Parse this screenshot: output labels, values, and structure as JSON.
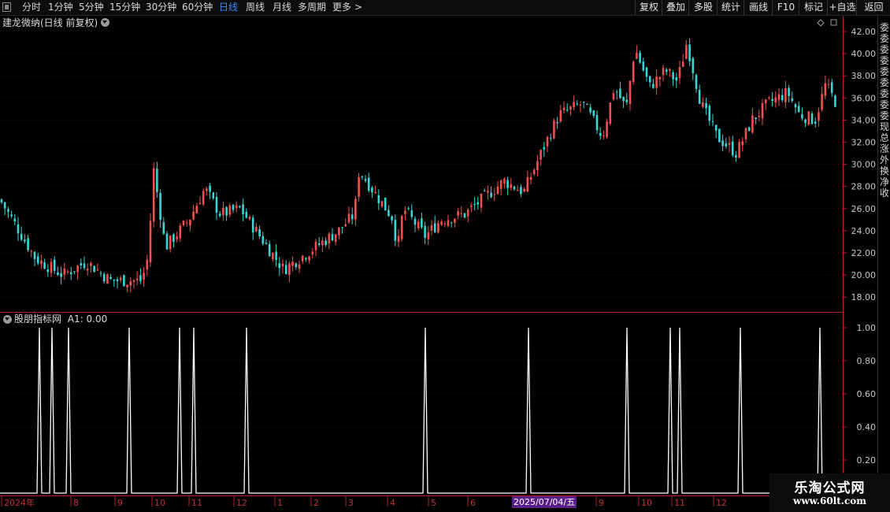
{
  "toolbar": {
    "periods": [
      {
        "label": "分时",
        "x": 28
      },
      {
        "label": "1分钟",
        "x": 61
      },
      {
        "label": "5分钟",
        "x": 100
      },
      {
        "label": "15分钟",
        "x": 139
      },
      {
        "label": "30分钟",
        "x": 185
      },
      {
        "label": "60分钟",
        "x": 231
      },
      {
        "label": "日线",
        "x": 278,
        "active": true
      },
      {
        "label": "周线",
        "x": 312
      },
      {
        "label": "月线",
        "x": 346
      },
      {
        "label": "多周期",
        "x": 378
      },
      {
        "label": "更多",
        "x": 422
      }
    ],
    "more_arrow": ">",
    "right_buttons": [
      "复权",
      "叠加",
      "多股",
      "统计",
      "画线",
      "F10",
      "标记",
      "+自选",
      "返回"
    ]
  },
  "main_chart": {
    "title": "建龙微纳(日线 前复权)",
    "y_ticks": [
      "42.00",
      "40.00",
      "38.00",
      "36.00",
      "34.00",
      "32.00",
      "30.00",
      "28.00",
      "26.00",
      "24.00",
      "22.00",
      "20.00",
      "18.00"
    ],
    "colors": {
      "up": "#f05050",
      "down": "#3ad6d6",
      "grid": "#5a1010",
      "axis": "#b0202a",
      "label": "#c8c8c8"
    }
  },
  "indicator": {
    "title": "股朋指标网",
    "series_label": "A1: 0.00",
    "y_ticks": [
      "1.00",
      "0.80",
      "0.60",
      "0.40",
      "0.20"
    ]
  },
  "x_axis": {
    "labels": [
      "2024年",
      "8",
      "9",
      "10",
      "11",
      "12",
      "1",
      "2",
      "3",
      "4",
      "5",
      "6",
      "7",
      "8",
      "9",
      "10",
      "11",
      "12"
    ],
    "cursor_date": "2025/07/04/五"
  },
  "right_strip": {
    "chars": [
      "委",
      "委",
      "委",
      "委",
      "委",
      "委",
      "委",
      "委",
      "委",
      "现",
      "总",
      "涨",
      "外",
      "换",
      "净",
      "收",
      "",
      "",
      "",
      "",
      "",
      "",
      "",
      "",
      "",
      "",
      "",
      "",
      "",
      "",
      "",
      "",
      "",
      "",
      "",
      "",
      "",
      "",
      "",
      "",
      "",
      "",
      "",
      ""
    ]
  },
  "watermark": {
    "title": "乐淘公式网",
    "url": "www.60lt.com"
  },
  "chart_data": {
    "type": "line",
    "description": "Daily stock price (candlestick) of 建龙微纳 with indicator A1 spikes",
    "price_anchors": [
      {
        "x": 0,
        "price": 26.8
      },
      {
        "x": 20,
        "price": 24.5
      },
      {
        "x": 45,
        "price": 21.5
      },
      {
        "x": 80,
        "price": 20.0
      },
      {
        "x": 110,
        "price": 21.2
      },
      {
        "x": 140,
        "price": 19.5
      },
      {
        "x": 180,
        "price": 19.5
      },
      {
        "x": 190,
        "price": 22.2
      },
      {
        "x": 193,
        "price": 30.5
      },
      {
        "x": 210,
        "price": 22.5
      },
      {
        "x": 240,
        "price": 25.0
      },
      {
        "x": 260,
        "price": 27.8
      },
      {
        "x": 280,
        "price": 25.5
      },
      {
        "x": 305,
        "price": 26.0
      },
      {
        "x": 330,
        "price": 23.5
      },
      {
        "x": 360,
        "price": 20.5
      },
      {
        "x": 400,
        "price": 22.5
      },
      {
        "x": 430,
        "price": 24.0
      },
      {
        "x": 450,
        "price": 25.5
      },
      {
        "x": 456,
        "price": 29.5
      },
      {
        "x": 475,
        "price": 27.5
      },
      {
        "x": 500,
        "price": 25.0
      },
      {
        "x": 504,
        "price": 22.0
      },
      {
        "x": 512,
        "price": 26.0
      },
      {
        "x": 540,
        "price": 23.5
      },
      {
        "x": 560,
        "price": 25.0
      },
      {
        "x": 590,
        "price": 25.5
      },
      {
        "x": 615,
        "price": 27.0
      },
      {
        "x": 640,
        "price": 28.5
      },
      {
        "x": 665,
        "price": 27.5
      },
      {
        "x": 690,
        "price": 31.5
      },
      {
        "x": 710,
        "price": 34.5
      },
      {
        "x": 740,
        "price": 35.5
      },
      {
        "x": 765,
        "price": 32.5
      },
      {
        "x": 780,
        "price": 37.0
      },
      {
        "x": 795,
        "price": 35.0
      },
      {
        "x": 806,
        "price": 40.5
      },
      {
        "x": 825,
        "price": 37.0
      },
      {
        "x": 845,
        "price": 38.5
      },
      {
        "x": 860,
        "price": 37.5
      },
      {
        "x": 872,
        "price": 41.0
      },
      {
        "x": 890,
        "price": 35.5
      },
      {
        "x": 910,
        "price": 32.5
      },
      {
        "x": 935,
        "price": 31.0
      },
      {
        "x": 955,
        "price": 34.0
      },
      {
        "x": 975,
        "price": 35.5
      },
      {
        "x": 1000,
        "price": 36.5
      },
      {
        "x": 1015,
        "price": 34.5
      },
      {
        "x": 1035,
        "price": 34.0
      },
      {
        "x": 1048,
        "price": 37.2
      },
      {
        "x": 1062,
        "price": 35.5
      }
    ],
    "indicator_spikes_x": [
      50,
      66,
      87,
      164,
      228,
      246,
      313,
      540,
      671,
      796,
      851,
      863,
      940,
      1041
    ],
    "ylim": [
      17,
      43
    ]
  }
}
